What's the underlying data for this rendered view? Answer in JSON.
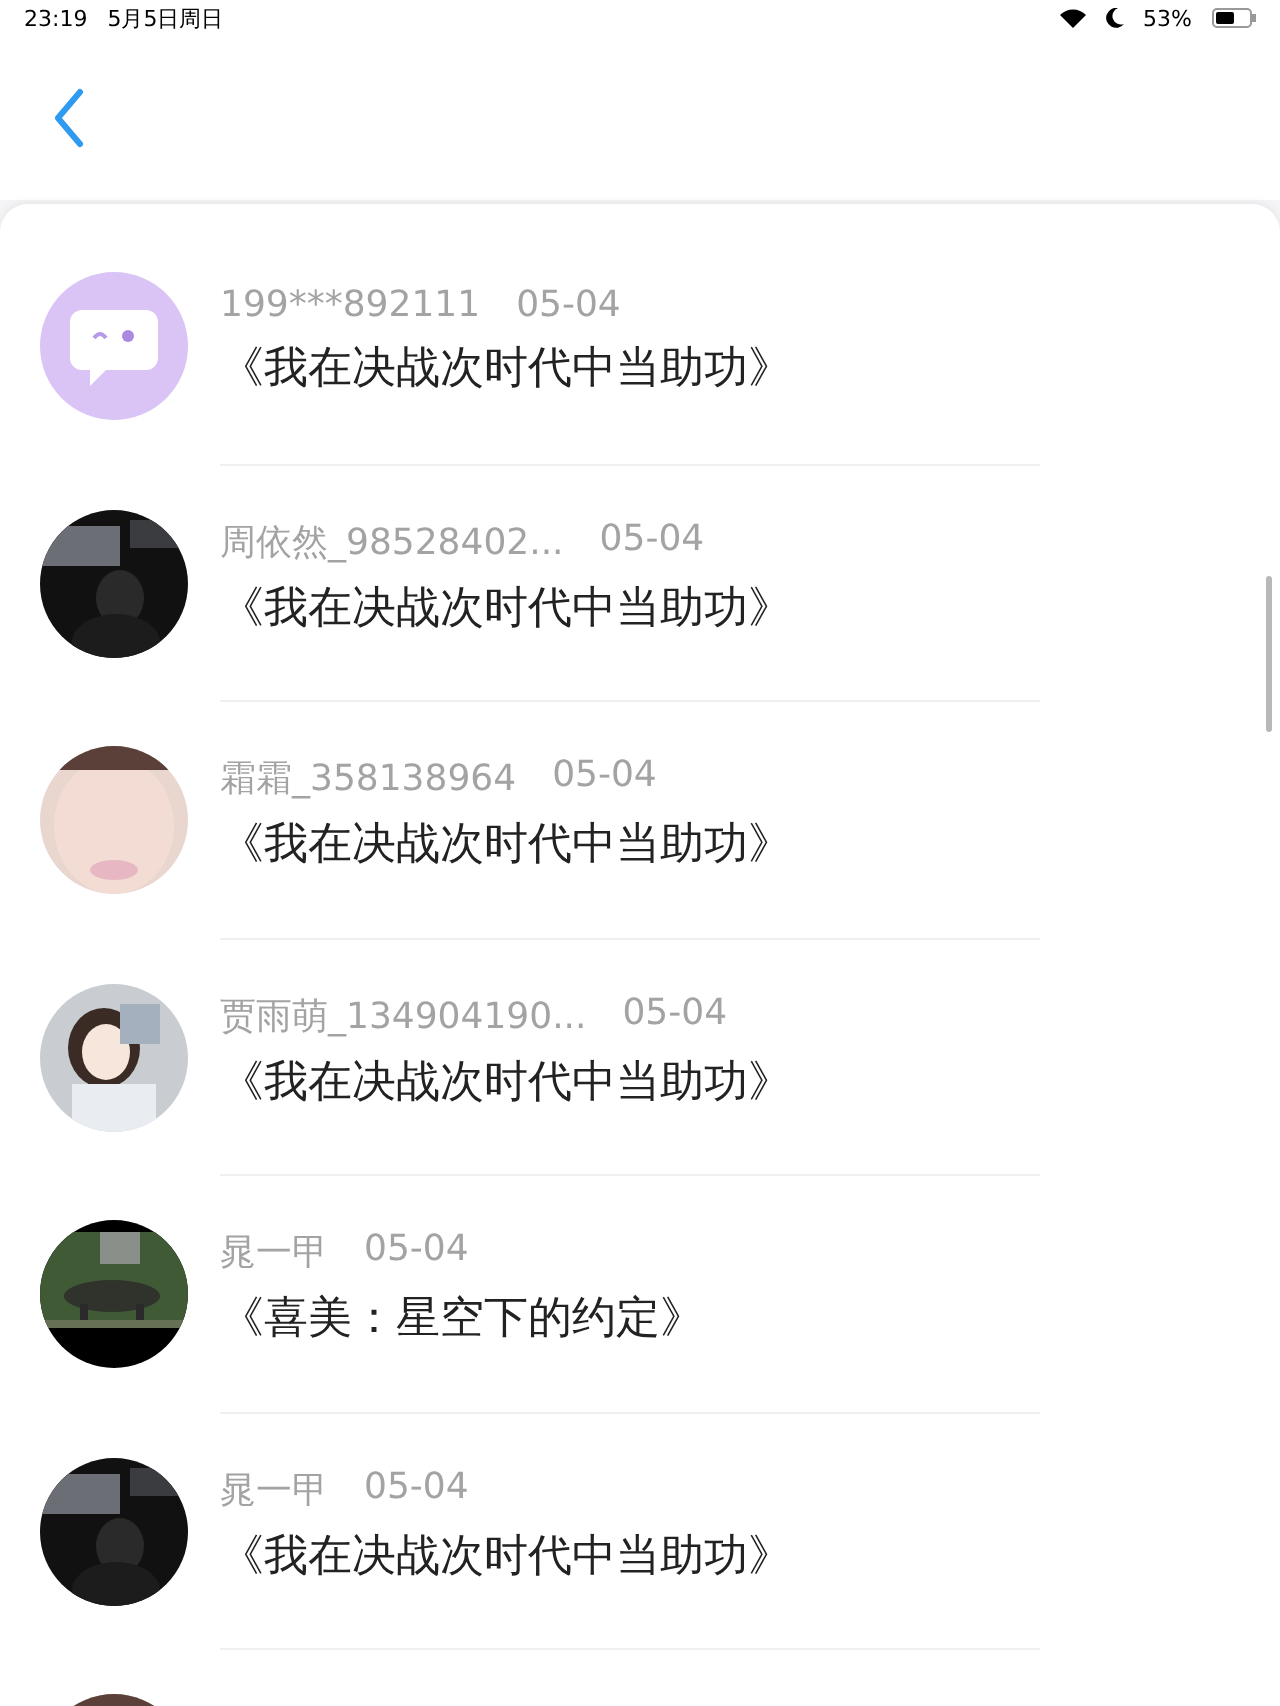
{
  "status_bar": {
    "time": "23:19",
    "date": "5月5日周日",
    "battery": "53%"
  },
  "rows": [
    {
      "avatar": {
        "kind": "icon"
      },
      "name": "199***892111",
      "date": "05-04",
      "title": "《我在决战次时代中当助功》"
    },
    {
      "avatar": {
        "kind": "picture"
      },
      "name": "周依然_98528402...",
      "date": "05-04",
      "title": "《我在决战次时代中当助功》"
    },
    {
      "avatar": {
        "kind": "picture"
      },
      "name": "霜霜_358138964",
      "date": "05-04",
      "title": "《我在决战次时代中当助功》"
    },
    {
      "avatar": {
        "kind": "picture"
      },
      "name": "贾雨萌_134904190...",
      "date": "05-04",
      "title": "《我在决战次时代中当助功》"
    },
    {
      "avatar": {
        "kind": "picture"
      },
      "name": "晁一甲",
      "date": "05-04",
      "title": "《喜美：星空下的约定》"
    },
    {
      "avatar": {
        "kind": "picture"
      },
      "name": "晁一甲",
      "date": "05-04",
      "title": "《我在决战次时代中当助功》"
    },
    {
      "avatar": {
        "kind": "picture"
      }
    }
  ]
}
